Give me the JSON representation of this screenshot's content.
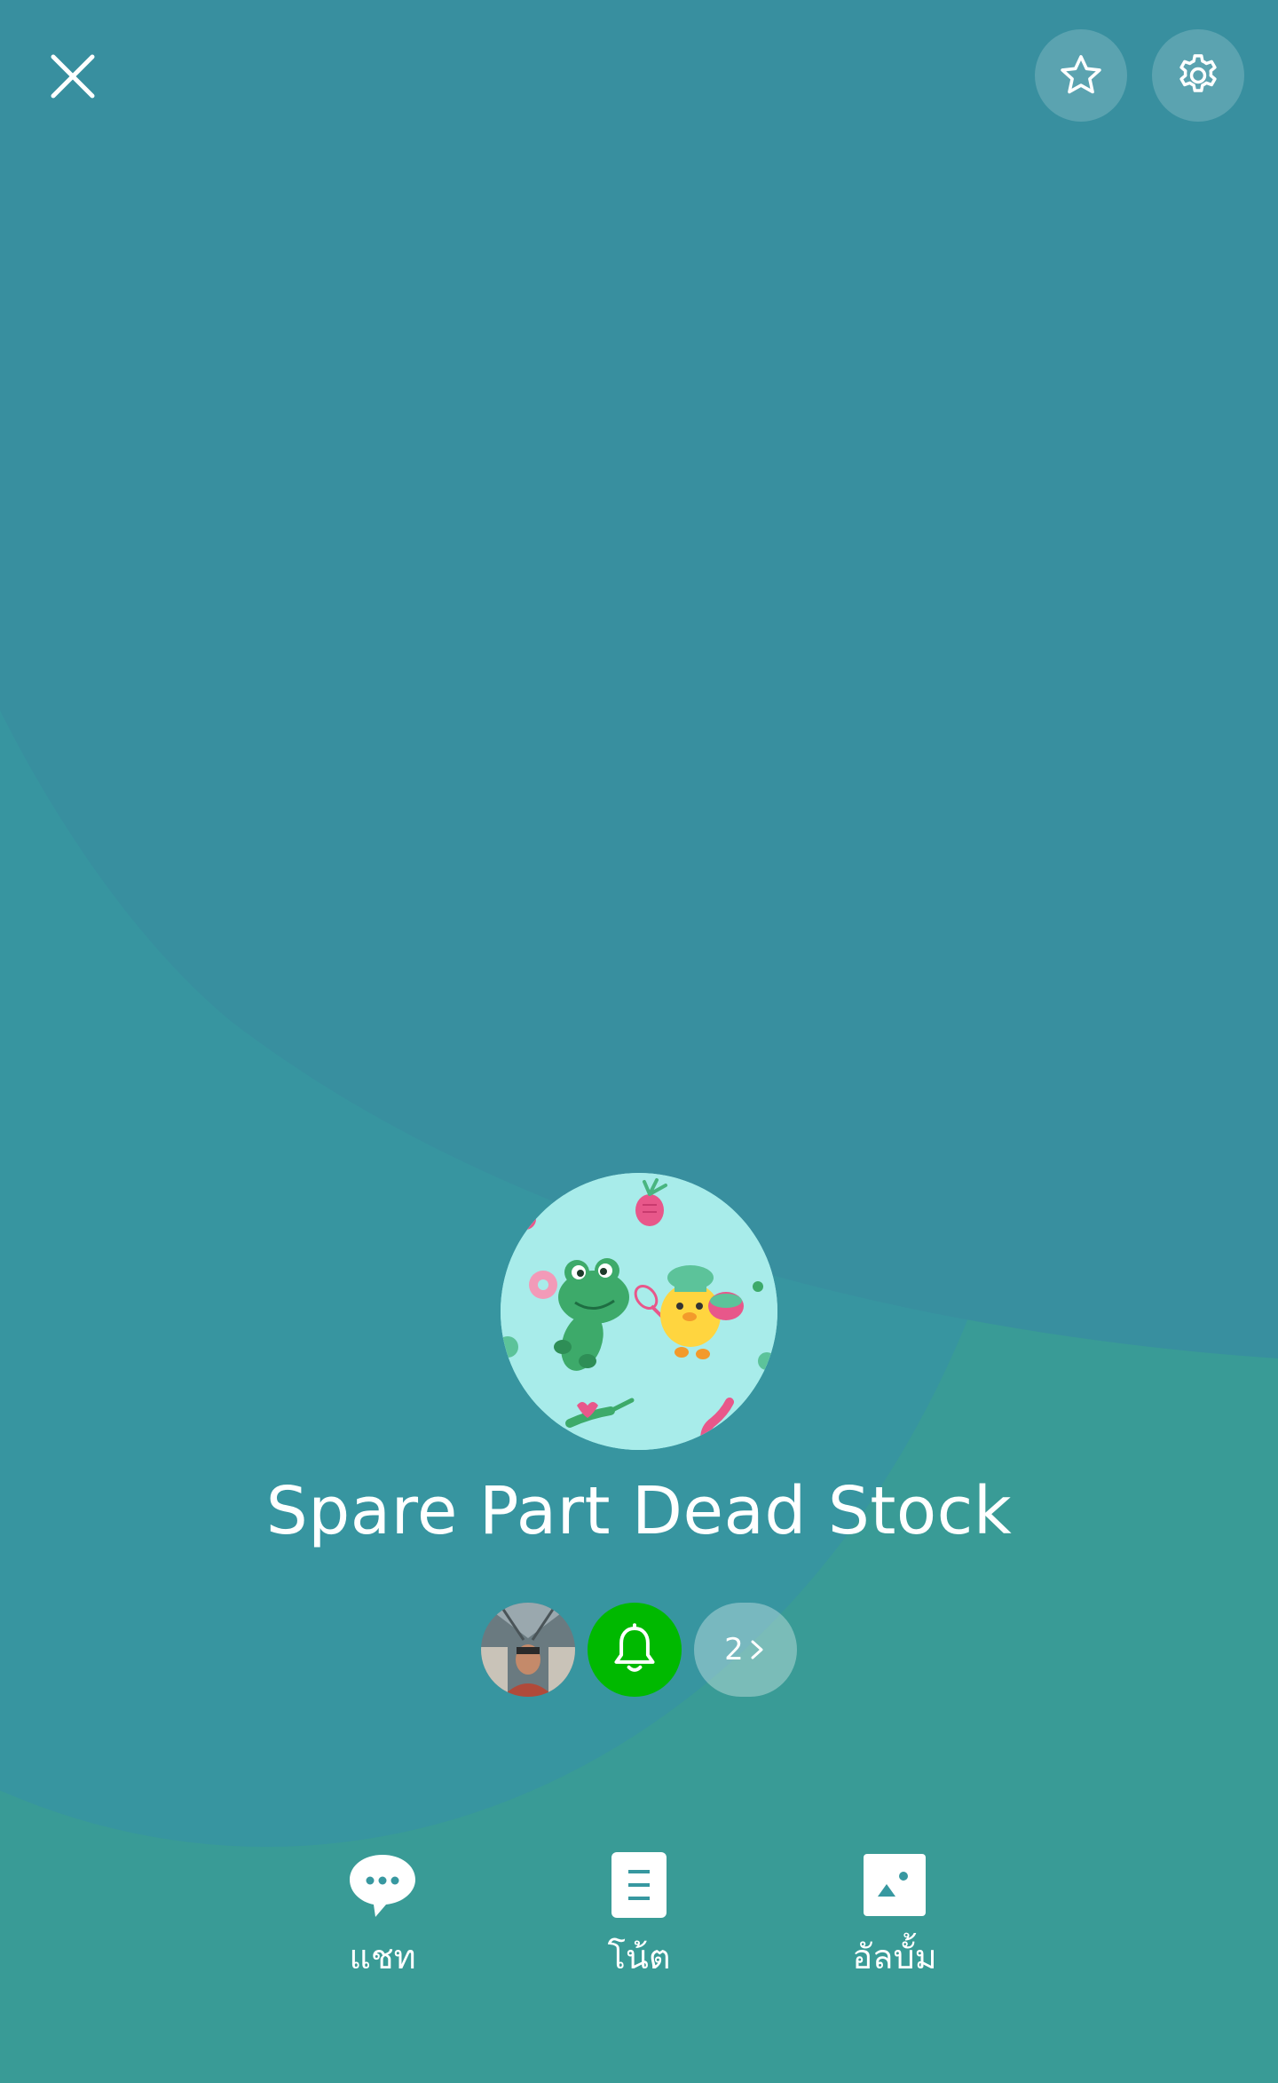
{
  "theme": {
    "background_top": "#388F9F",
    "background_bottom": "#399B96",
    "notify_green": "#00B900",
    "text": "#FFFFFF"
  },
  "header": {
    "close_icon": "close-icon",
    "favorite_icon": "star-icon",
    "settings_icon": "gear-icon"
  },
  "group": {
    "name": "Spare Part Dead Stock",
    "avatar_icon": "group-avatar"
  },
  "members": {
    "notify_icon": "bell-icon",
    "count_label": "2"
  },
  "actions": [
    {
      "label": "แชท",
      "icon": "chat-bubble-icon"
    },
    {
      "label": "โน้ต",
      "icon": "note-icon"
    },
    {
      "label": "อัลบั้ม",
      "icon": "album-icon"
    }
  ]
}
